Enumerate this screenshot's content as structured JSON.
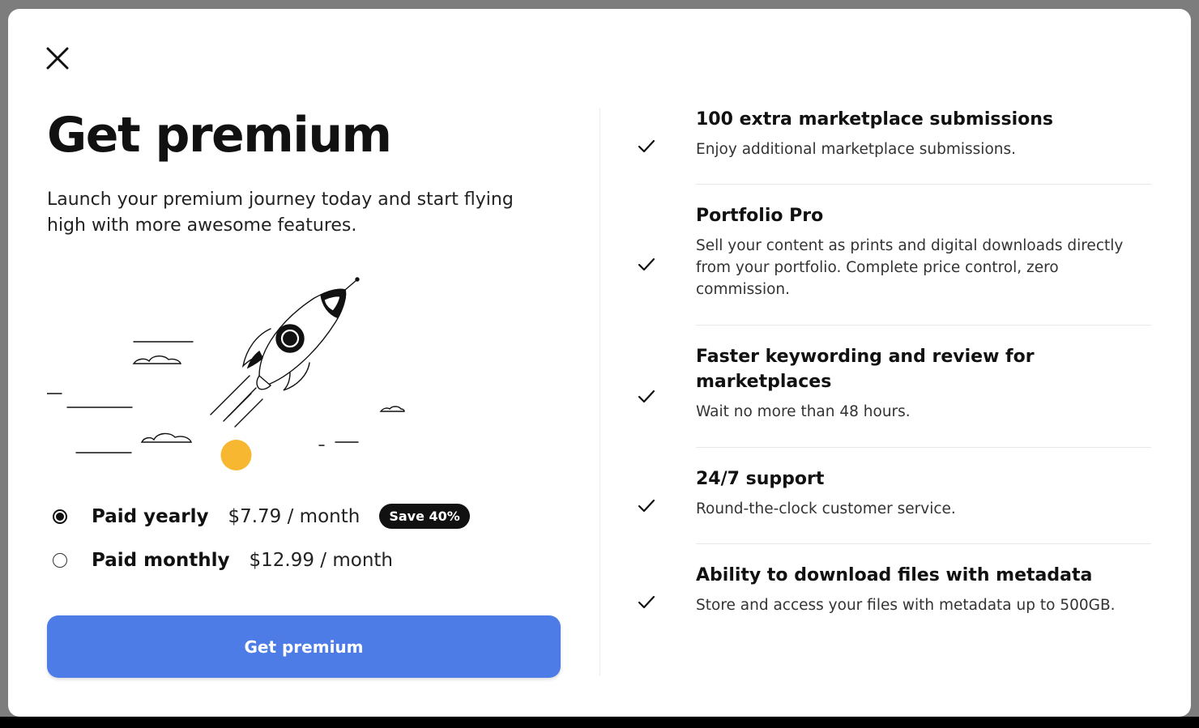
{
  "dialog": {
    "title": "Get premium",
    "subtitle": "Launch your premium journey today and start flying high with more awesome features.",
    "close_icon": "close-icon",
    "illustration": "rocket-illustration"
  },
  "plans": [
    {
      "label": "Paid yearly",
      "price": "$7.79 / month",
      "badge": "Save 40%",
      "selected": true
    },
    {
      "label": "Paid monthly",
      "price": "$12.99 / month",
      "selected": false
    }
  ],
  "cta": {
    "label": "Get premium"
  },
  "features": [
    {
      "title": "100 extra marketplace submissions",
      "description": "Enjoy additional marketplace submissions.",
      "icon": "check-icon"
    },
    {
      "title": "Portfolio Pro",
      "description": "Sell your content as prints and digital downloads directly from your portfolio. Complete price control, zero commission.",
      "icon": "check-icon"
    },
    {
      "title": "Faster keywording and review for marketplaces",
      "description": "Wait no more than 48 hours.",
      "icon": "check-icon"
    },
    {
      "title": "24/7 support",
      "description": "Round-the-clock customer service.",
      "icon": "check-icon"
    },
    {
      "title": "Ability to download files with metadata",
      "description": "Store and access your files with metadata up to 500GB.",
      "icon": "check-icon"
    }
  ],
  "colors": {
    "cta_background": "#4d7ce6",
    "badge_background": "#111111",
    "sun": "#f7b731",
    "overlay": "#7d7d7d"
  }
}
